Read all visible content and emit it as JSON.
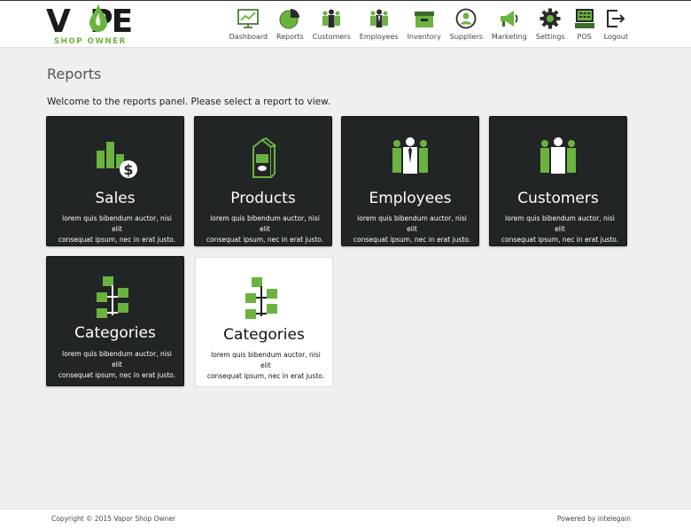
{
  "brand": {
    "logo_text": "VAPE",
    "logo_sub": "SHOP OWNER",
    "accent": "#6bb33f",
    "dark": "#222525"
  },
  "nav": {
    "items": [
      {
        "label": "Dashboard",
        "icon": "dashboard-icon"
      },
      {
        "label": "Reports",
        "icon": "pie-chart-icon"
      },
      {
        "label": "Customers",
        "icon": "customers-icon"
      },
      {
        "label": "Employees",
        "icon": "employees-icon"
      },
      {
        "label": "Inventory",
        "icon": "inventory-box-icon"
      },
      {
        "label": "Suppliers",
        "icon": "suppliers-icon"
      },
      {
        "label": "Marketing",
        "icon": "megaphone-icon"
      },
      {
        "label": "Settings",
        "icon": "gear-icon"
      },
      {
        "label": "POS",
        "icon": "pos-register-icon"
      },
      {
        "label": "Logout",
        "icon": "logout-icon"
      }
    ]
  },
  "main": {
    "title": "Reports",
    "intro": "Welcome to the reports panel. Please select a report to view.",
    "cards": [
      {
        "title": "Sales",
        "desc_line1": "lorem quis bibendum auctor, nisi elit",
        "desc_line2": "consequat ipsum, nec in erat justo.",
        "icon": "sales-chart-dollar-icon",
        "style": "dark"
      },
      {
        "title": "Products",
        "desc_line1": "lorem quis bibendum auctor, nisi elit",
        "desc_line2": "consequat ipsum, nec in erat justo.",
        "icon": "product-carton-icon",
        "style": "dark"
      },
      {
        "title": "Employees",
        "desc_line1": "lorem quis bibendum auctor, nisi elit",
        "desc_line2": "consequat ipsum, nec in erat justo.",
        "icon": "employees-icon",
        "style": "dark"
      },
      {
        "title": "Customers",
        "desc_line1": "lorem quis bibendum auctor, nisi elit",
        "desc_line2": "consequat ipsum, nec in erat justo.",
        "icon": "customers-icon",
        "style": "dark"
      },
      {
        "title": "Categories",
        "desc_line1": "lorem quis bibendum auctor, nisi elit",
        "desc_line2": "consequat ipsum, nec in erat justo.",
        "icon": "category-tree-icon",
        "style": "dark"
      },
      {
        "title": "Categories",
        "desc_line1": "lorem quis bibendum auctor, nisi elit",
        "desc_line2": "consequat ipsum, nec in erat justo.",
        "icon": "category-tree-icon",
        "style": "light"
      }
    ]
  },
  "footer": {
    "copyright": "Copyright © 2015 Vapor Shop Owner",
    "powered": "Powered by intelegain"
  }
}
